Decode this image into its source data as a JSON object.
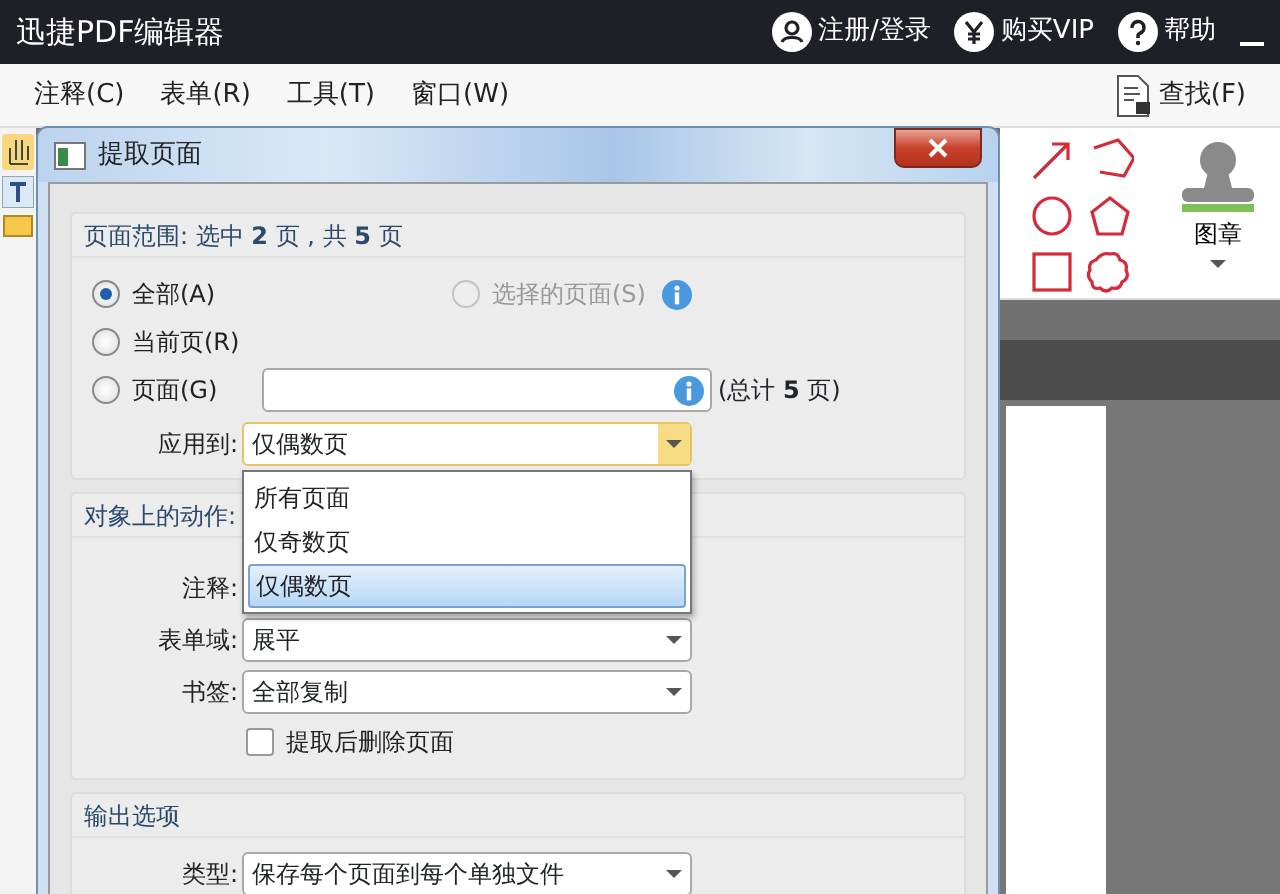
{
  "app": {
    "title": "迅捷PDF编辑器",
    "header_links": [
      {
        "label": "注册/登录"
      },
      {
        "label": "购买VIP"
      },
      {
        "label": "帮助"
      }
    ]
  },
  "menu": [
    "注释(C)",
    "表单(R)",
    "工具(T)",
    "窗口(W)"
  ],
  "search": {
    "label": "查找(F)"
  },
  "stamp": {
    "label": "图章"
  },
  "dialog": {
    "title": "提取页面",
    "range": {
      "heading": "页面范围: 选中 **2** 页 , 共 **5** 页",
      "options": [
        {
          "label": "全部(A)",
          "selected": true,
          "disabled": false
        },
        {
          "label": "当前页(R)",
          "selected": false,
          "disabled": false
        },
        {
          "label": "页面(G)",
          "selected": false,
          "disabled": false
        },
        {
          "label": "选择的页面(S)",
          "selected": false,
          "disabled": true
        }
      ],
      "total_note": "(总计 **5** 页)",
      "apply_to": {
        "label": "应用到:",
        "value": "仅偶数页",
        "expanded": true,
        "options": [
          {
            "label": "所有页面",
            "selected": false
          },
          {
            "label": "仅奇数页",
            "selected": false
          },
          {
            "label": "仅偶数页",
            "selected": true
          }
        ]
      }
    },
    "actions": {
      "heading": "对象上的动作:",
      "fields": [
        {
          "label": "注释:"
        },
        {
          "label": "表单域:",
          "value": "展平"
        },
        {
          "label": "书签:",
          "value": "全部复制"
        }
      ],
      "checkbox": {
        "label": "提取后删除页面",
        "checked": false
      }
    },
    "output": {
      "heading": "输出选项",
      "fields": [
        {
          "label": "类型:",
          "value": "保存每个页面到每个单独文件"
        }
      ]
    }
  }
}
